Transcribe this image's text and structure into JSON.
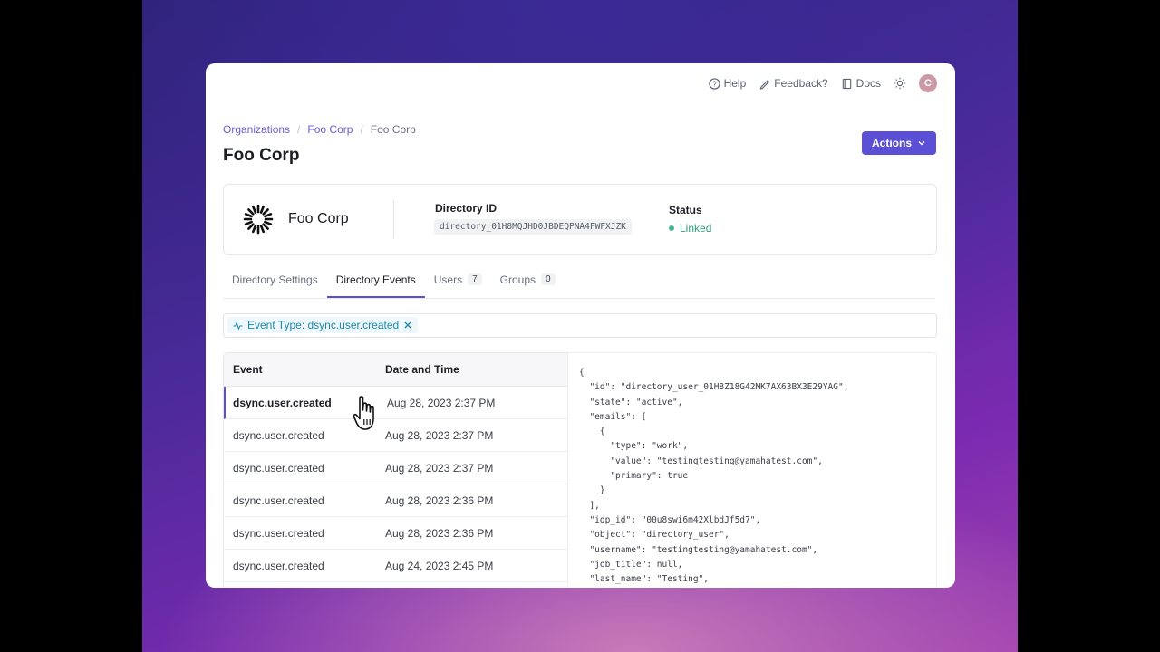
{
  "topbar": {
    "help": "Help",
    "feedback": "Feedback?",
    "docs": "Docs",
    "avatar_initial": "C"
  },
  "breadcrumb": [
    "Organizations",
    "Foo Corp",
    "Foo Corp"
  ],
  "page_title": "Foo Corp",
  "actions_label": "Actions",
  "org_card": {
    "name": "Foo Corp",
    "directory_id_label": "Directory ID",
    "directory_id": "directory_01H8MQJHD0JBDEQPNA4FWFXJZK",
    "status_label": "Status",
    "status": "Linked"
  },
  "tabs": [
    {
      "label": "Directory Settings",
      "badge": ""
    },
    {
      "label": "Directory Events",
      "badge": ""
    },
    {
      "label": "Users",
      "badge": "7"
    },
    {
      "label": "Groups",
      "badge": "0"
    }
  ],
  "filter_chip": "Event Type: dsync.user.created",
  "table": {
    "headers": [
      "Event",
      "Date and Time"
    ],
    "rows": [
      {
        "event": "dsync.user.created",
        "date": "Aug 28, 2023 2:37 PM"
      },
      {
        "event": "dsync.user.created",
        "date": "Aug 28, 2023 2:37 PM"
      },
      {
        "event": "dsync.user.created",
        "date": "Aug 28, 2023 2:37 PM"
      },
      {
        "event": "dsync.user.created",
        "date": "Aug 28, 2023 2:36 PM"
      },
      {
        "event": "dsync.user.created",
        "date": "Aug 28, 2023 2:36 PM"
      },
      {
        "event": "dsync.user.created",
        "date": "Aug 24, 2023 2:45 PM"
      }
    ]
  },
  "json_lines": [
    "{",
    "  \"id\": \"directory_user_01H8Z18G42MK7AX63BX3E29YAG\",",
    "  \"state\": \"active\",",
    "  \"emails\": [",
    "    {",
    "      \"type\": \"work\",",
    "      \"value\": \"testingtesting@yamahatest.com\",",
    "      \"primary\": true",
    "    }",
    "  ],",
    "  \"idp_id\": \"00u8swi6m42XlbdJf5d7\",",
    "  \"object\": \"directory_user\",",
    "  \"username\": \"testingtesting@yamahatest.com\",",
    "  \"job_title\": null,",
    "  \"last_name\": \"Testing\","
  ],
  "colors": {
    "accent": "#5b4fd6",
    "status_green": "#45b88f",
    "chip_blue": "#1f8ab0"
  },
  "icons": [
    "help-icon",
    "feedback-icon",
    "docs-icon",
    "sun-icon",
    "chevron-down-icon",
    "pulse-icon",
    "close-icon",
    "hand-cursor-icon"
  ]
}
